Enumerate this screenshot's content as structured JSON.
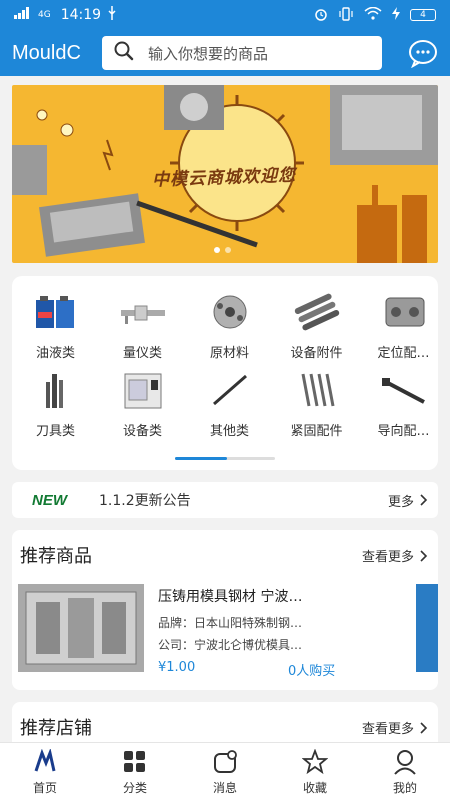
{
  "status": {
    "network": "4G",
    "time": "14:19",
    "battery": "4"
  },
  "header": {
    "brand": "MouldC",
    "search_placeholder": "输入你想要的商品"
  },
  "banner": {
    "text": "中模云商城欢迎您"
  },
  "categories": [
    {
      "label": "油液类",
      "icon": "oil-icon"
    },
    {
      "label": "量仪类",
      "icon": "gauge-icon"
    },
    {
      "label": "原材料",
      "icon": "raw-material-icon"
    },
    {
      "label": "设备附件",
      "icon": "equipment-accessory-icon"
    },
    {
      "label": "定位配…",
      "icon": "positioning-icon"
    },
    {
      "label": "刀具类",
      "icon": "cutter-icon"
    },
    {
      "label": "设备类",
      "icon": "machine-icon"
    },
    {
      "label": "其他类",
      "icon": "other-icon"
    },
    {
      "label": "紧固配件",
      "icon": "fastener-icon"
    },
    {
      "label": "导向配…",
      "icon": "guide-icon"
    }
  ],
  "notice": {
    "tag": "NEW",
    "text": "1.1.2更新公告",
    "more": "更多"
  },
  "recommend_products": {
    "title": "推荐商品",
    "more": "查看更多",
    "items": [
      {
        "name": "压铸用模具钢材 宁波…",
        "brand": "品牌：日本山阳特殊制钢…",
        "company": "公司：宁波北仑博优模具…",
        "price": "¥1.00",
        "buyers": "0人购买"
      }
    ]
  },
  "recommend_shops": {
    "title": "推荐店铺",
    "more": "查看更多"
  },
  "tabbar": [
    {
      "label": "首页",
      "icon": "home-icon"
    },
    {
      "label": "分类",
      "icon": "category-icon"
    },
    {
      "label": "消息",
      "icon": "message-icon"
    },
    {
      "label": "收藏",
      "icon": "star-icon"
    },
    {
      "label": "我的",
      "icon": "profile-icon"
    }
  ],
  "colors": {
    "primary": "#1e87d8",
    "banner": "#f5b731",
    "new_tag": "#127a33"
  }
}
